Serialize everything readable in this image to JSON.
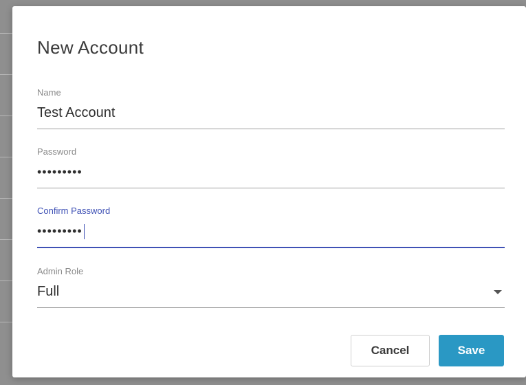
{
  "dialog": {
    "title": "New Account",
    "fields": {
      "name": {
        "label": "Name",
        "value": "Test Account"
      },
      "password": {
        "label": "Password",
        "value": "•••••••••"
      },
      "confirm_password": {
        "label": "Confirm Password",
        "value": "•••••••••"
      },
      "admin_role": {
        "label": "Admin Role",
        "value": "Full",
        "icon": "chevron-down-icon"
      }
    },
    "buttons": {
      "cancel": "Cancel",
      "save": "Save"
    }
  },
  "colors": {
    "focus_accent": "#3f51b5",
    "primary_button": "#2a98c4",
    "backdrop": "#8f8f8f"
  }
}
